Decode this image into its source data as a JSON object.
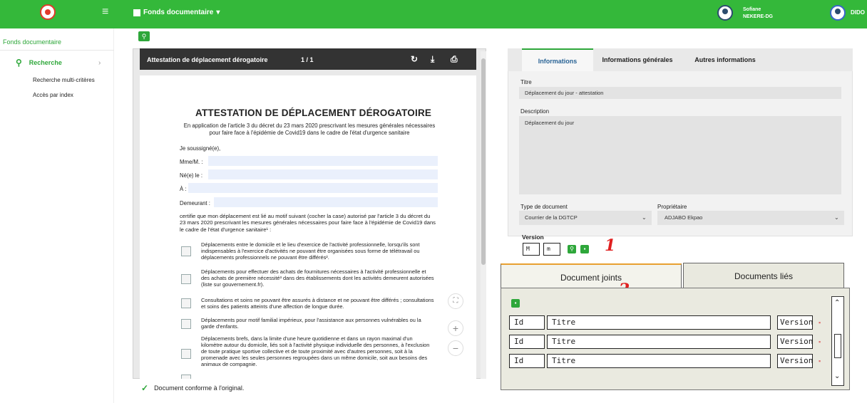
{
  "topbar": {
    "module": "Fonds documentaire",
    "user_first": "Sofiane",
    "user_last": "NEKERE-DG",
    "user2": "DIDO",
    "brand_color": "#34b83a"
  },
  "sidebar": {
    "header": "Fonds documentaire",
    "menu_label": "Recherche",
    "subitems": [
      "Recherche multi-critères",
      "Accès par index"
    ]
  },
  "viewer": {
    "title": "Attestation de déplacement dérogatoire",
    "page": "1 / 1",
    "doc": {
      "heading": "ATTESTATION DE DÉPLACEMENT DÉROGATOIRE",
      "intro": "En application de l'article 3 du décret du 23 mars 2020 prescrivant les mesures générales nécessaires pour faire face à l'épidémie de Covid19 dans le cadre de l'état d'urgence sanitaire",
      "undersigned": "Je soussigné(e),",
      "fields": [
        "Mme/M. :",
        "Né(e) le :",
        "À :",
        "Demeurant :"
      ],
      "certify": "certifie que mon déplacement est lié au motif suivant (cocher la case) autorisé par l'article 3 du décret du 23 mars 2020 prescrivant les mesures générales nécessaires pour faire face à l'épidémie de Covid19 dans le cadre de l'état d'urgence sanitaire¹ :",
      "reasons": [
        "Déplacements entre le domicile et le lieu d'exercice de l'activité professionnelle, lorsqu'ils sont indispensables à l'exercice d'activités ne pouvant être organisées sous forme de télétravail ou déplacements professionnels ne pouvant être différés².",
        "Déplacements pour effectuer des achats de fournitures nécessaires à l'activité professionnelle et des achats de première nécessité³ dans des établissements dont les activités demeurent autorisées (liste sur gouvernement.fr).",
        "Consultations et soins ne pouvant être assurés à distance et ne pouvant être différés ; consultations et soins des patients atteints d'une affection de longue durée.",
        "Déplacements pour motif familial impérieux, pour l'assistance aux personnes vulnérables ou la garde d'enfants.",
        "Déplacements brefs, dans la limite d'une heure quotidienne et dans un rayon maximal d'un kilomètre autour du domicile, liés soit à l'activité physique individuelle des personnes, à l'exclusion de toute pratique sportive collective et de toute proximité avec d'autres personnes, soit à la promenade avec les seules personnes regroupées dans un même domicile, soit aux besoins des animaux de compagnie."
      ]
    },
    "conform": "Document conforme à l'original."
  },
  "info": {
    "tabs": [
      "Informations",
      "Informations générales",
      "Autres informations"
    ],
    "titre_label": "Titre",
    "titre_value": "Déplacement du jour - attestation",
    "desc_label": "Description",
    "desc_value": "Déplacement du jour",
    "type_label": "Type de document",
    "type_value": "Courrier de la DGTCP",
    "owner_label": "Propriétaire",
    "owner_value": "ADJABO Ekpao",
    "version_label": "Version",
    "version_major": "M",
    "version_minor": "m",
    "annot1": "1",
    "annot2": "2"
  },
  "attachments": {
    "tabs": [
      "Document joints",
      "Documents liés"
    ],
    "rows": [
      {
        "id": "Id",
        "title": "Titre",
        "version": "Version"
      },
      {
        "id": "Id",
        "title": "Titre",
        "version": "Version"
      },
      {
        "id": "Id",
        "title": "Titre",
        "version": "Version"
      }
    ]
  }
}
